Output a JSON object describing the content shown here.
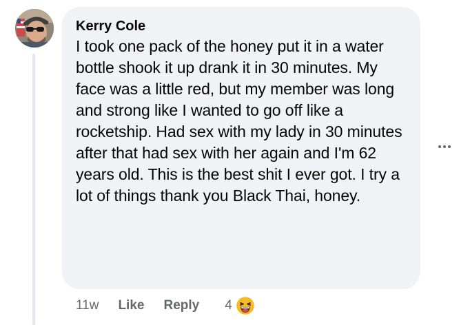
{
  "comment": {
    "author": "Kerry Cole",
    "text": "I took one pack of the honey put it in a water bottle shook it up drank it in 30 minutes. My face was a little red, but my member was long and strong like I wanted to go off like a rocketship. Had sex with my lady in 30 minutes after that had sex with her again and I'm 62 years old. This is the best shit I ever got. I try a lot of things thank you Black Thai, honey.",
    "time": "11w",
    "like_label": "Like",
    "reply_label": "Reply",
    "reaction_count": "4",
    "reaction_icon": "haha-emoji-icon",
    "avatar_icon": "user-avatar"
  },
  "colors": {
    "bubble": "#f0f2f5",
    "secondary_text": "#65676b",
    "primary_text": "#050505",
    "thread_line": "#e4e6eb",
    "emoji_yellow": "#f7b928"
  }
}
